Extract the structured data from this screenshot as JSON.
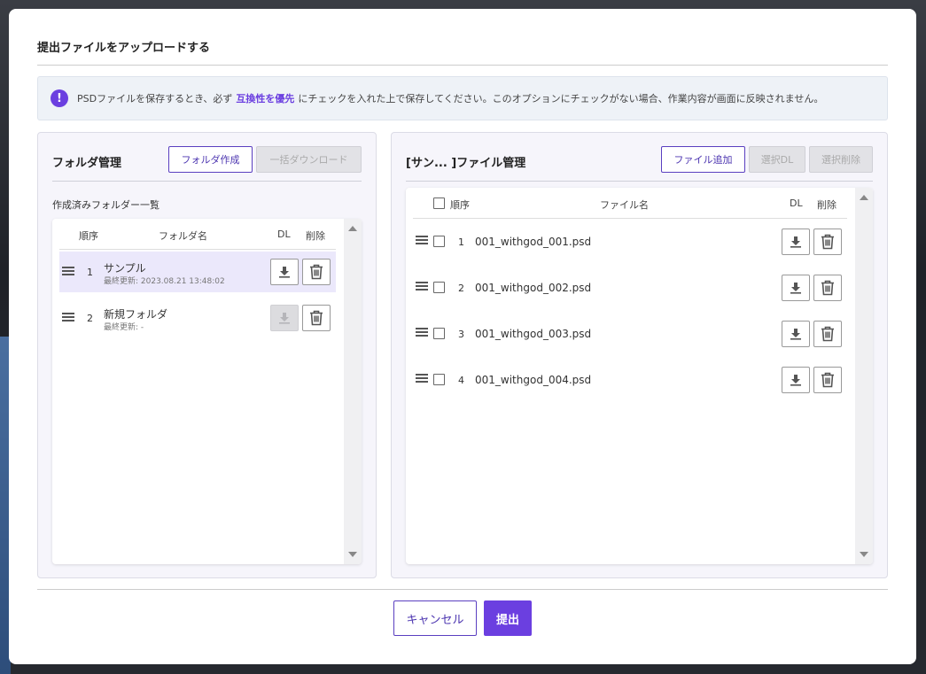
{
  "modal": {
    "title": "提出ファイルをアップロードする",
    "notice": {
      "before": "PSDファイルを保存するとき、必ず",
      "highlight": "互換性を優先",
      "after": "にチェックを入れた上で保存してください。このオプションにチェックがない場合、作業内容が画面に反映されません。"
    },
    "accent_color": "#6b3fe0"
  },
  "folder_panel": {
    "title": "フォルダ管理",
    "create_button": "フォルダ作成",
    "bulk_download_button": "一括ダウンロード",
    "list_label": "作成済みフォルダー一覧",
    "columns": {
      "order": "順序",
      "name": "フォルダ名",
      "dl": "DL",
      "delete": "削除"
    },
    "folders": [
      {
        "order": "1",
        "name": "サンプル",
        "updated": "最終更新: 2023.08.21 13:48:02",
        "selected": true,
        "dl_enabled": true
      },
      {
        "order": "2",
        "name": "新規フォルダ",
        "updated": "最終更新: -",
        "selected": false,
        "dl_enabled": false
      }
    ]
  },
  "file_panel": {
    "title": "[サン... ]ファイル管理",
    "add_button": "ファイル追加",
    "selected_dl_button": "選択DL",
    "selected_delete_button": "選択削除",
    "columns": {
      "order": "順序",
      "name": "ファイル名",
      "dl": "DL",
      "delete": "削除"
    },
    "files": [
      {
        "order": "1",
        "name": "001_withgod_001.psd"
      },
      {
        "order": "2",
        "name": "001_withgod_002.psd"
      },
      {
        "order": "3",
        "name": "001_withgod_003.psd"
      },
      {
        "order": "4",
        "name": "001_withgod_004.psd"
      }
    ]
  },
  "footer": {
    "cancel_button": "キャンセル",
    "submit_button": "提出"
  }
}
